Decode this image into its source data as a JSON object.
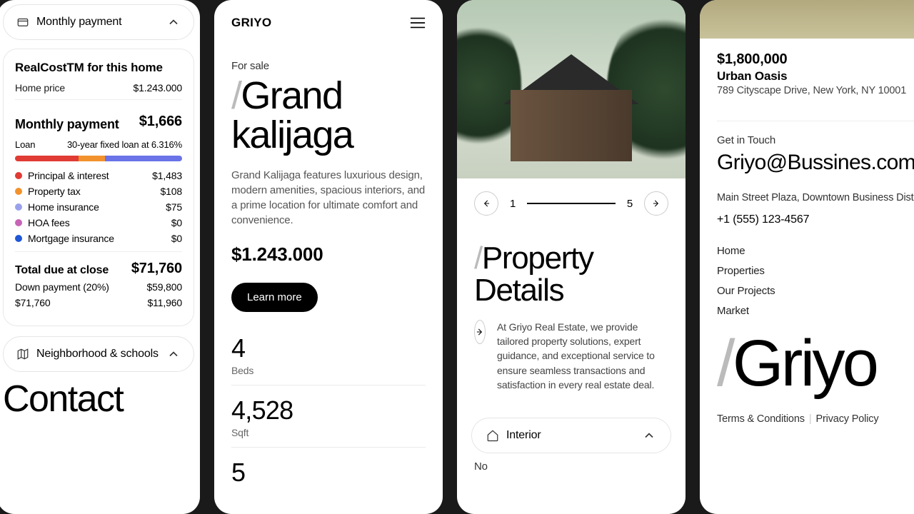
{
  "cost_panel": {
    "monthly_payment_title": "Monthly payment",
    "card_title": "RealCostTM for this home",
    "home_price_label": "Home price",
    "home_price_value": "$1.243.000",
    "monthly_label": "Monthly payment",
    "monthly_value": "$1,666",
    "loan_label": "Loan",
    "loan_desc": "30-year fixed loan at 6.316%",
    "segments": [
      {
        "color": "#e03b34",
        "pct": 38
      },
      {
        "color": "#f2922c",
        "pct": 16
      },
      {
        "color": "#6a73e8",
        "pct": 46
      }
    ],
    "lines": [
      {
        "color": "#e03b34",
        "label": "Principal & interest",
        "value": "$1,483"
      },
      {
        "color": "#f2922c",
        "label": "Property tax",
        "value": "$108"
      },
      {
        "color": "#9aa1ec",
        "label": "Home insurance",
        "value": "$75"
      },
      {
        "color": "#c764b6",
        "label": "HOA fees",
        "value": "$0"
      },
      {
        "color": "#1f57d6",
        "label": "Mortgage insurance",
        "value": "$0"
      }
    ],
    "total_label": "Total due at close",
    "total_value": "$71,760",
    "down_label": "Down payment (20%)",
    "down_value": "$59,800",
    "closing_label": "$71,760",
    "closing_value": "$11,960",
    "neighborhood_title": "Neighborhood & schools",
    "contact_heading": "Contact"
  },
  "listing": {
    "brand": "GRIYO",
    "tag": "For sale",
    "title": "Grand kalijaga",
    "desc": "Grand Kalijaga features luxurious design, modern amenities, spacious interiors, and a prime location for ultimate comfort and convenience.",
    "price": "$1.243.000",
    "learn": "Learn more",
    "stats": [
      {
        "num": "4",
        "lbl": "Beds"
      },
      {
        "num": "4,528",
        "lbl": "Sqft"
      },
      {
        "num": "5",
        "lbl": ""
      }
    ]
  },
  "details": {
    "current": "1",
    "total": "5",
    "title": "Property Details",
    "desc": "At Griyo Real Estate, we provide tailored property solutions, expert guidance, and exceptional service to ensure seamless transactions and satisfaction in every real estate deal.",
    "accordion": "Interior",
    "partial": "No"
  },
  "footer": {
    "price": "$1,800,000",
    "name": "Urban Oasis",
    "address": "789 Cityscape Drive, New York, NY 10001",
    "git": "Get in Touch",
    "email": "Griyo@Bussines.com",
    "addr": "Main Street Plaza, Downtown Business Distr",
    "phone": "+1 (555) 123-4567",
    "nav": [
      "Home",
      "Properties",
      "Our Projects",
      "Market"
    ],
    "logo": "Griyo",
    "terms": "Terms & Conditions",
    "privacy": "Privacy Policy"
  }
}
